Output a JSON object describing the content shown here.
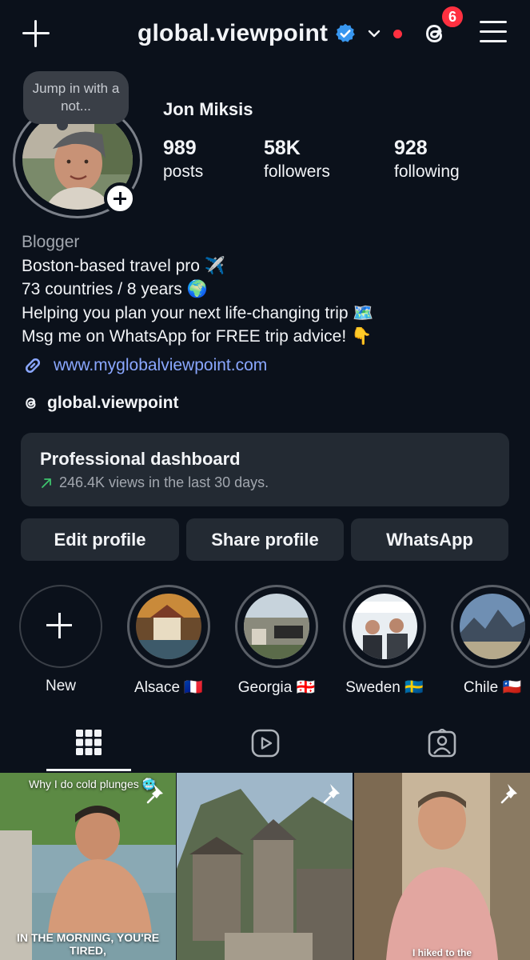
{
  "header": {
    "username": "global.viewpoint",
    "notification_count": "6",
    "icons": [
      "plus-icon",
      "verified-badge-icon",
      "chevron-down-icon",
      "threads-icon",
      "menu-icon"
    ]
  },
  "profile": {
    "note": "Jump in with a not...",
    "full_name": "Jon Miksis",
    "stats": [
      {
        "value": "989",
        "label": "posts"
      },
      {
        "value": "58K",
        "label": "followers"
      },
      {
        "value": "928",
        "label": "following"
      }
    ],
    "category": "Blogger",
    "bio_lines": [
      "Boston-based travel pro ✈️",
      "73 countries / 8 years 🌍",
      "Helping you plan your next life-changing trip 🗺️",
      "Msg me on WhatsApp for FREE trip advice! 👇"
    ],
    "link": "www.myglobalviewpoint.com",
    "threads_handle": "global.viewpoint"
  },
  "dashboard": {
    "title": "Professional dashboard",
    "subtitle": "246.4K views in the last 30 days."
  },
  "actions": [
    "Edit profile",
    "Share profile",
    "WhatsApp"
  ],
  "highlights": [
    {
      "label": "New"
    },
    {
      "label": "Alsace 🇫🇷"
    },
    {
      "label": "Georgia 🇬🇪"
    },
    {
      "label": "Sweden 🇸🇪"
    },
    {
      "label": "Chile 🇨🇱"
    }
  ],
  "tabs": [
    "grid-icon",
    "reels-icon",
    "tagged-icon"
  ],
  "posts": [
    {
      "caption_top": "Why I do cold plunges 🥶",
      "caption_bottom": "IN THE MORNING, YOU'RE TIRED,"
    },
    {
      "caption_top": "",
      "caption_bottom": ""
    },
    {
      "caption_top": "",
      "caption_bottom": "I hiked to the"
    }
  ],
  "colors": {
    "background": "#0b111b",
    "card": "#232a33",
    "link": "#8aa7ff",
    "badge": "#ff3040",
    "verified": "#3897f0"
  }
}
